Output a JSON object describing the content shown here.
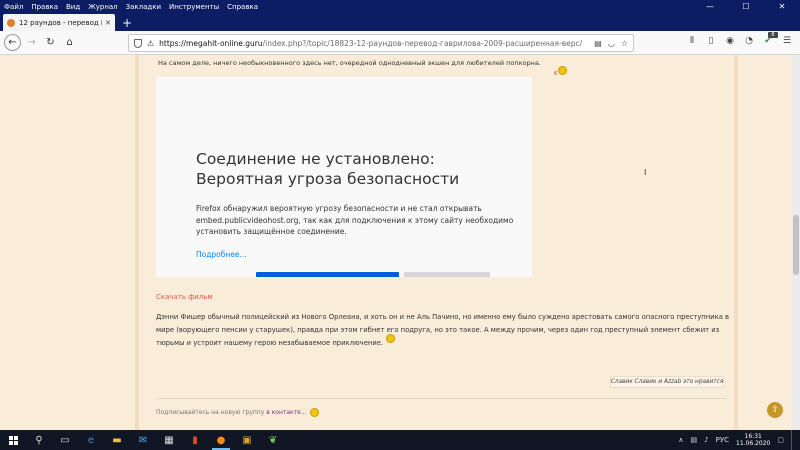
{
  "menu": {
    "items": [
      "Файл",
      "Правка",
      "Вид",
      "Журнал",
      "Закладки",
      "Инструменты",
      "Справка"
    ]
  },
  "window_controls": {
    "minimize": "—",
    "maximize": "☐",
    "close": "✕"
  },
  "tab": {
    "title": "12 раундов - перевод Гаврил",
    "close": "✕",
    "new_tab": "+"
  },
  "urlbar": {
    "host": "https://megahit-online.guru",
    "path": "/index.php?/topic/18823-12-раундов-перевод-гаврилова-2009-расширенная-верс/"
  },
  "post": {
    "top_line": "На самом деле, ничего необыкновенного здесь нет, очередной однодневный экшен для любителей попкорна.",
    "top_mark": "6",
    "download_link": "Скачать фильм",
    "description": [
      "Дэнни Фишер обычный полицейский из Нового Орлеана, и хоть он и не Аль Пачино, но именно ему было суждено арестовать самого опасного преступника в",
      "мире (ворующего пенсии у старушек), правда при этом гибнет его подруга, но это такое. А между прочим, через один год преступный элемент сбежит из",
      "тюрьмы и устроит нашему герою незабываемое приключение."
    ],
    "likes": "Славик Славик и Azzab это нравится",
    "subscribe_text": "Подписывайтесь на новую группу",
    "subscribe_link": "в контакте..."
  },
  "error_page": {
    "title_line1": "Соединение не установлено:",
    "title_line2": "Вероятная угроза безопасности",
    "desc_lines": [
      "Firefox обнаружил вероятную угрозу безопасности и не стал открывать",
      "embed.publicvideohost.org, так как для подключения к этому сайту необходимо",
      "установить защищённое соединение."
    ],
    "more_link": "Подробнее..."
  },
  "taskbar": {
    "language": "РУС",
    "time": "16:31",
    "date": "11.06.2020"
  }
}
